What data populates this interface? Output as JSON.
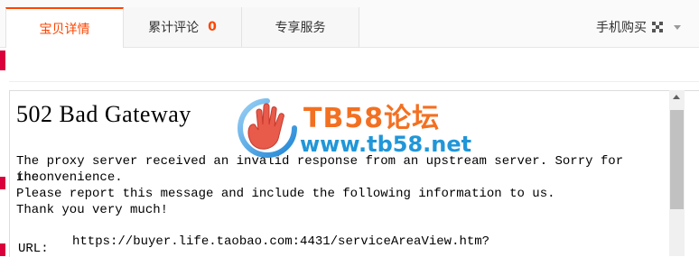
{
  "tabs": {
    "details": "宝贝详情",
    "reviews": "累计评论",
    "reviews_count": "0",
    "services": "专享服务"
  },
  "mobile_buy": "手机购买",
  "error": {
    "title": "502 Bad Gateway",
    "line1": "The proxy server received an invalid response from an upstream server. Sorry for the",
    "line2": "inconvenience.",
    "line3": "Please report this message and include the following information to us.",
    "line4": "Thank you very much!",
    "url_label": "URL:",
    "url_value": "https://buyer.life.taobao.com:4431/serviceAreaView.htm?"
  },
  "watermark": {
    "title": "TB58论坛",
    "url": "www.tb58.net"
  },
  "colors": {
    "accent": "#ff4400",
    "watermark_orange": "#f37021",
    "watermark_blue": "#2196d8"
  }
}
